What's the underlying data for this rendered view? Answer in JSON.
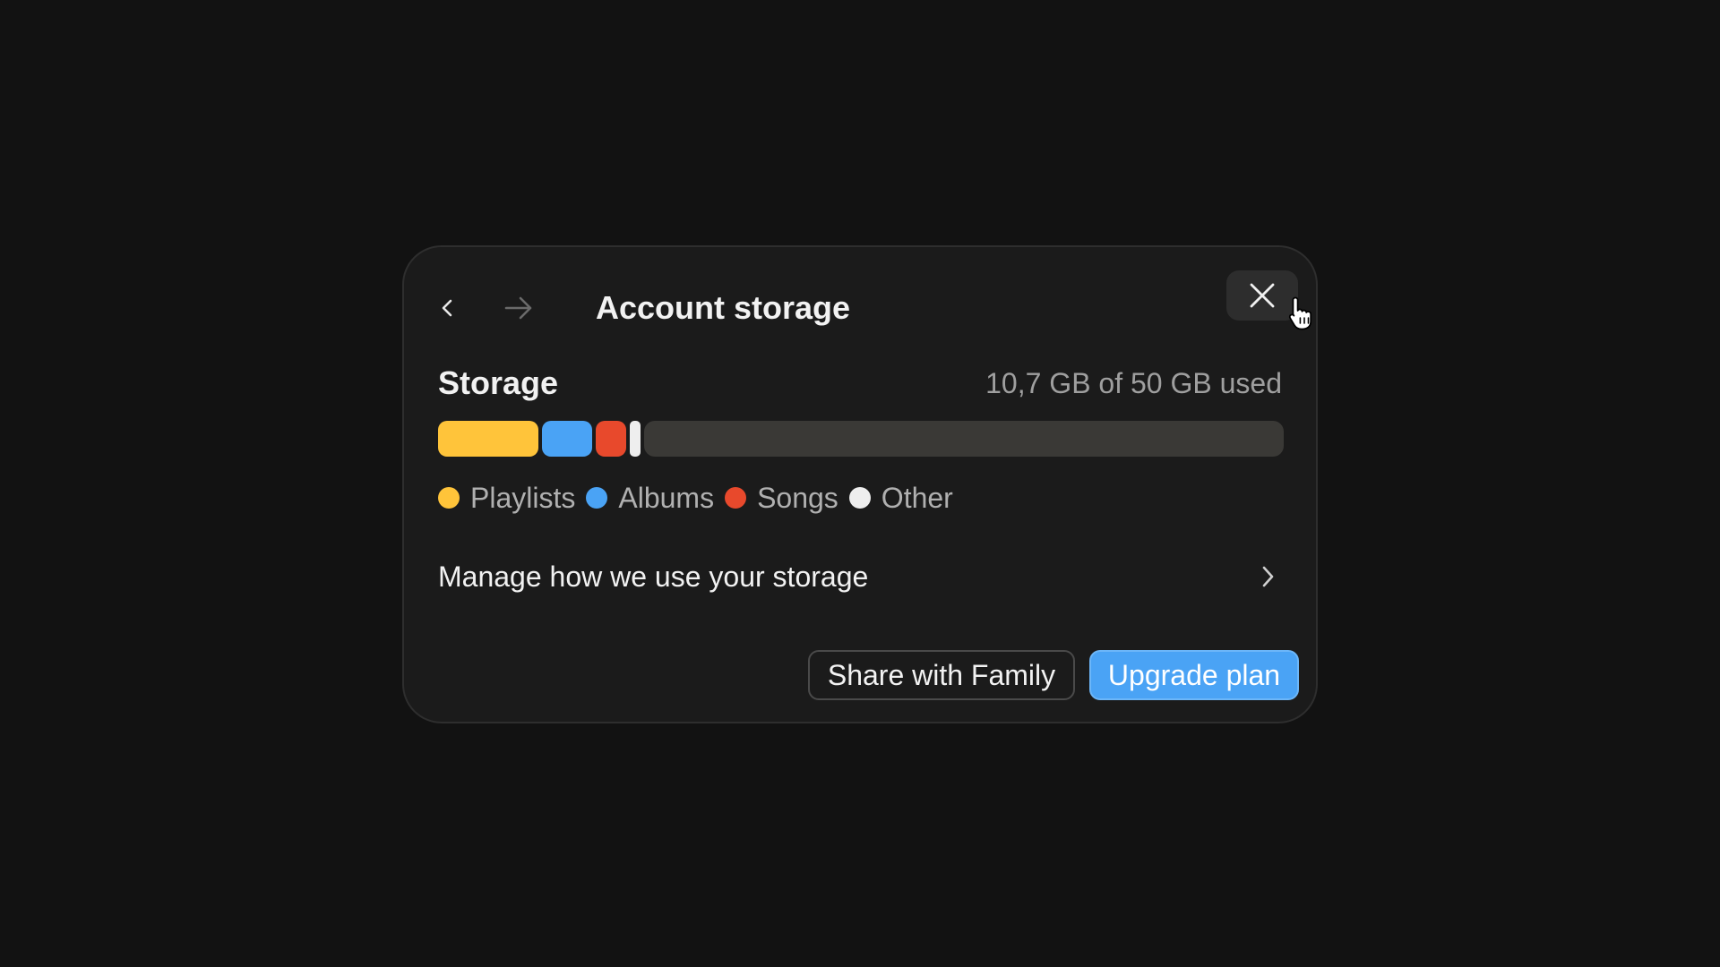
{
  "dialog": {
    "title": "Account storage",
    "nav": {
      "back_icon": "chevron-left-icon",
      "forward_icon": "arrow-right-icon",
      "forward_enabled": false
    },
    "close_icon": "close-icon"
  },
  "storage": {
    "label": "Storage",
    "used_text": "10,7 GB of 50 GB used",
    "used_gb": 10.7,
    "total_gb": 50,
    "segments": [
      {
        "key": "playlists",
        "color": "#ffc43a"
      },
      {
        "key": "albums",
        "color": "#4aa3f5"
      },
      {
        "key": "songs",
        "color": "#e8492c"
      },
      {
        "key": "other",
        "color": "#eeeeee"
      }
    ],
    "legend": [
      {
        "label": "Playlists",
        "color": "#ffc43a"
      },
      {
        "label": "Albums",
        "color": "#4aa3f5"
      },
      {
        "label": "Songs",
        "color": "#e8492c"
      },
      {
        "label": "Other",
        "color": "#eeeeee"
      }
    ]
  },
  "manage": {
    "label": "Manage how we use your storage",
    "icon": "chevron-right-icon"
  },
  "actions": {
    "share_label": "Share with Family",
    "upgrade_label": "Upgrade plan"
  },
  "colors": {
    "background": "#121212",
    "dialog": "#1b1b1b",
    "accent": "#4aa3f5"
  }
}
